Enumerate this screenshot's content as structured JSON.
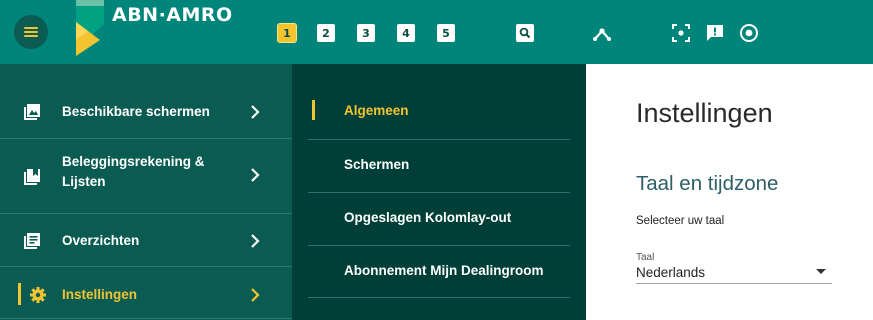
{
  "brand": {
    "name": "ABN·AMRO",
    "accent": "#f4c430",
    "primary": "#00857a"
  },
  "topbar": {
    "menu_icon": "hamburger-icon",
    "workspaces": [
      "1",
      "2",
      "3",
      "4",
      "5"
    ],
    "active_workspace": "1",
    "icons": [
      "search-icon",
      "network-icon",
      "scan-icon",
      "feedback-icon",
      "target-icon"
    ]
  },
  "sidebar": {
    "items": [
      {
        "label": "Beschikbare schermen",
        "icon": "screens-icon"
      },
      {
        "label": "Beleggingsrekening & Lijsten",
        "icon": "bookmark-list-icon"
      },
      {
        "label": "Overzichten",
        "icon": "overview-icon"
      },
      {
        "label": "Instellingen",
        "icon": "gear-icon",
        "active": true
      }
    ]
  },
  "submenu": {
    "items": [
      {
        "label": "Algemeen",
        "active": true
      },
      {
        "label": "Schermen"
      },
      {
        "label": "Opgeslagen Kolomlay-out"
      },
      {
        "label": "Abonnement Mijn Dealingroom"
      }
    ]
  },
  "content": {
    "title": "Instellingen",
    "section_title": "Taal en tijdzone",
    "select_language_label": "Selecteer uw taal",
    "language_field": {
      "label": "Taal",
      "value": "Nederlands"
    }
  }
}
